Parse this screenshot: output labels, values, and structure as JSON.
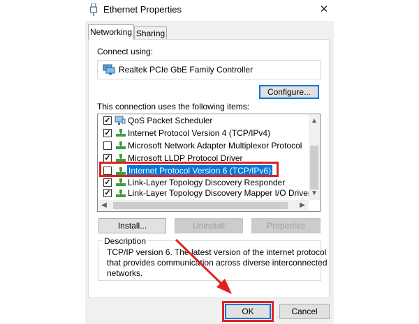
{
  "window": {
    "title": "Ethernet Properties",
    "close_glyph": "✕"
  },
  "tabs": [
    {
      "label": "Networking",
      "active": true
    },
    {
      "label": "Sharing",
      "active": false
    }
  ],
  "connect_using": {
    "label": "Connect using:",
    "adapter": "Realtek PCIe GbE Family Controller",
    "configure_label": "Configure..."
  },
  "items_section": {
    "label": "This connection uses the following items:",
    "items": [
      {
        "label": "QoS Packet Scheduler",
        "checked": true,
        "icon": "qos-scheduler-icon"
      },
      {
        "label": "Internet Protocol Version 4 (TCP/IPv4)",
        "checked": true,
        "icon": "protocol-icon"
      },
      {
        "label": "Microsoft Network Adapter Multiplexor Protocol",
        "checked": false,
        "icon": "protocol-icon"
      },
      {
        "label": "Microsoft LLDP Protocol Driver",
        "checked": true,
        "icon": "protocol-icon"
      },
      {
        "label": "Internet Protocol Version 6 (TCP/IPv6)",
        "checked": false,
        "icon": "protocol-icon",
        "selected": true
      },
      {
        "label": "Link-Layer Topology Discovery Responder",
        "checked": true,
        "icon": "protocol-icon"
      },
      {
        "label": "Link-Layer Topology Discovery Mapper I/O Driver",
        "checked": true,
        "icon": "protocol-icon"
      }
    ]
  },
  "actions": {
    "install_label": "Install...",
    "uninstall_label": "Uninstall",
    "properties_label": "Properties"
  },
  "description": {
    "label": "Description",
    "text_line1": "TCP/IP version 6. The latest version of the internet protocol",
    "text_line2": "that provides communication across diverse interconnected",
    "text_line3": "networks."
  },
  "footer": {
    "ok_label": "OK",
    "cancel_label": "Cancel"
  },
  "colors": {
    "selection": "#0078d7",
    "annotation_red": "#e02020",
    "dialog_bg": "#f0f0f0"
  }
}
